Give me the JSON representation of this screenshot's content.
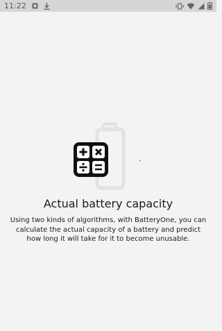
{
  "status_bar": {
    "time": "11:22",
    "left_icons": [
      "notification-icon",
      "download-icon"
    ],
    "right_icons": [
      "vibrate-icon",
      "wifi-icon",
      "signal-icon",
      "battery-icon"
    ]
  },
  "onboarding": {
    "title": "Actual battery capacity",
    "description": "Using two kinds of algorithms, with BatteryOne, you can calculate the actual capacity of a battery and predict how long it will take for it to become unusable.",
    "illustration_icons": [
      "battery-outline-icon",
      "calculator-icon"
    ]
  },
  "colors": {
    "background": "#f3f3f3",
    "status_bar": "#d6d6d6",
    "text": "#1a1a1a",
    "icon": "#111111",
    "battery_outline": "#e2e2e2"
  }
}
